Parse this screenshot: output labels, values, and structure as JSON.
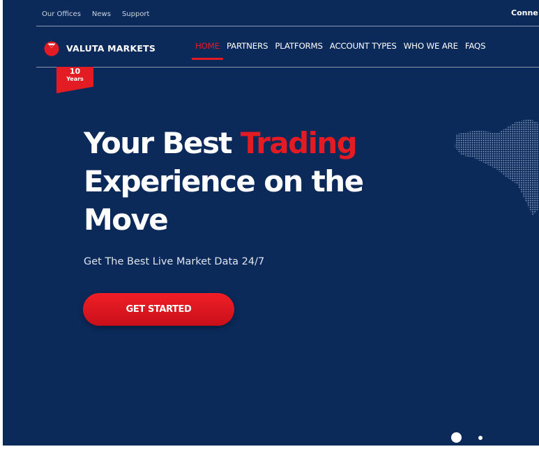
{
  "topbar": {
    "links": [
      "Our Offices",
      "News",
      "Support"
    ],
    "connect_label": "Conne"
  },
  "brand": {
    "name": "VALUTA MARKETS",
    "logo_icon": "valuta-logo-icon",
    "logo_color": "#e31b23"
  },
  "nav": {
    "items": [
      "HOME",
      "PARTNERS",
      "PLATFORMS",
      "ACCOUNT TYPES",
      "WHO WE ARE",
      "FAQS"
    ],
    "active": "HOME"
  },
  "badge": {
    "number": "10",
    "label": "Years"
  },
  "hero": {
    "title_part1": "Your Best ",
    "title_accent": "Trading",
    "title_line2": "Experience on the",
    "title_line3": "Move",
    "subtitle": "Get The Best Live Market Data 24/7",
    "cta_label": "GET STARTED"
  },
  "slider": {
    "dot_count": 2,
    "active_index": 0
  },
  "colors": {
    "background": "#0b2a5a",
    "accent": "#e31b23",
    "text": "#ffffff"
  }
}
